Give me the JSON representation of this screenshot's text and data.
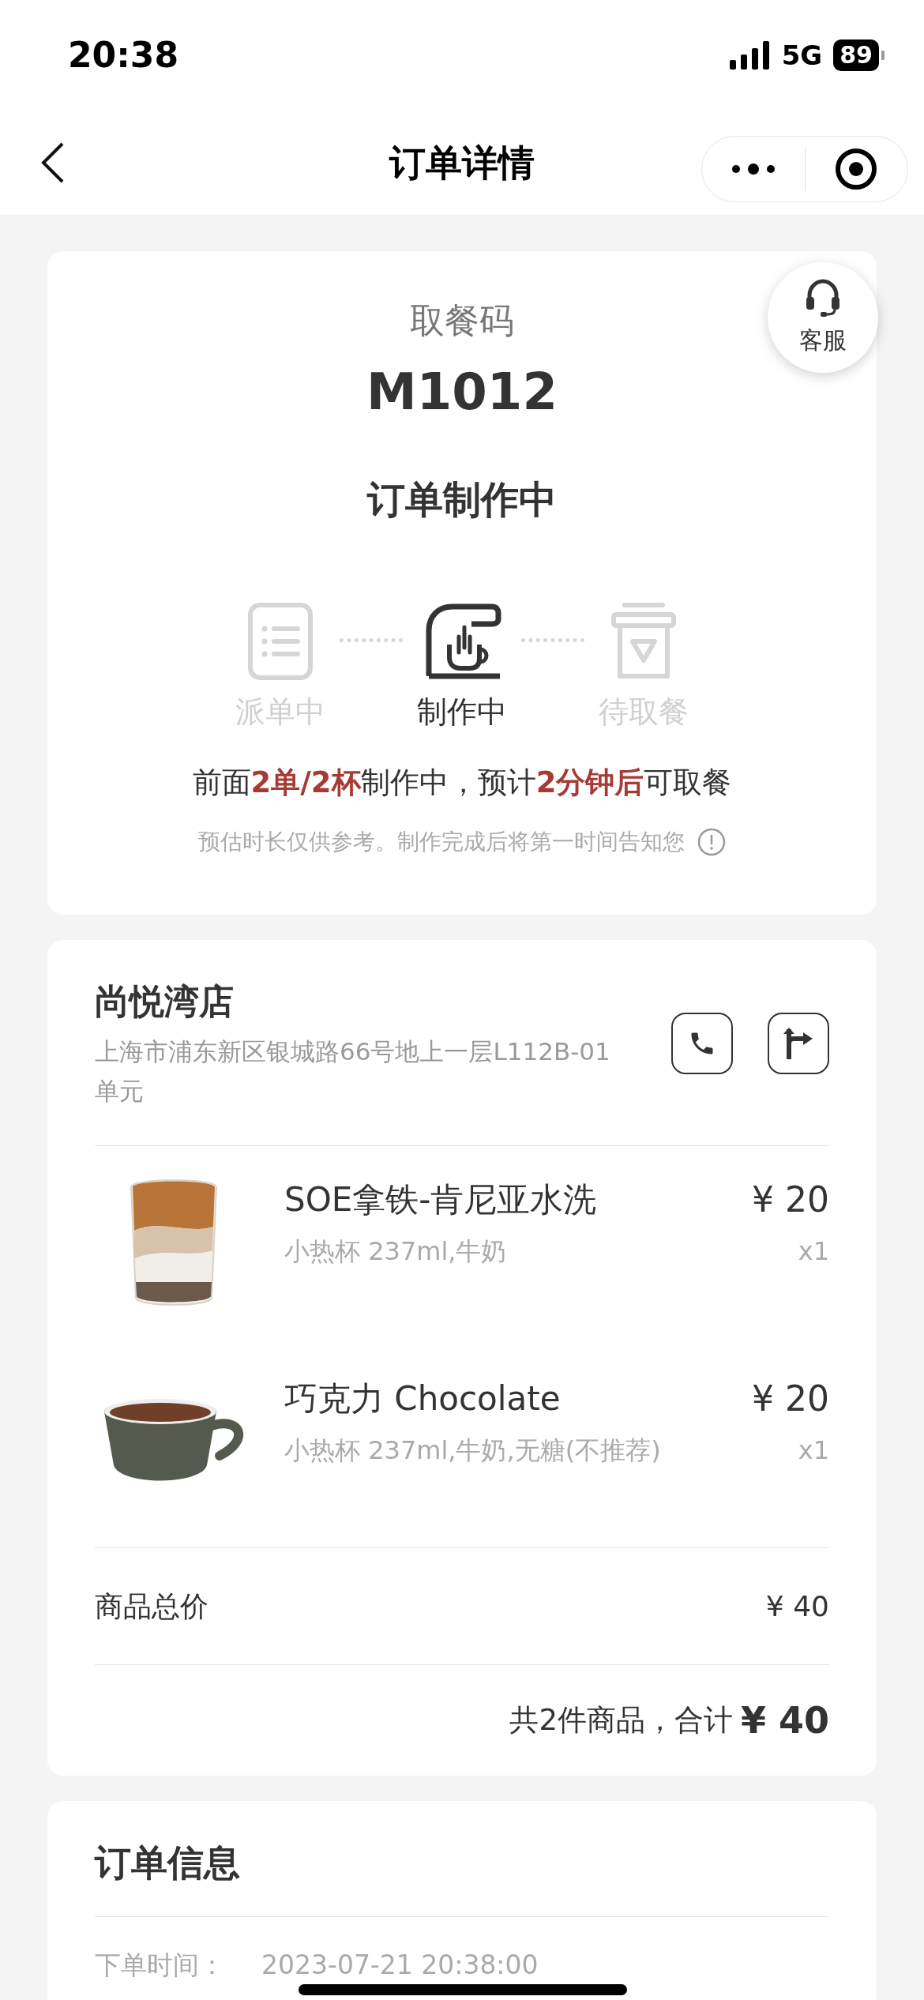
{
  "status_bar": {
    "time": "20:38",
    "network": "5G",
    "battery": "89"
  },
  "nav": {
    "title": "订单详情"
  },
  "pickup": {
    "label": "取餐码",
    "code": "M1012",
    "status": "订单制作中",
    "service": "客服",
    "steps": [
      {
        "kind": "dispatch",
        "label": "派单中",
        "selected": false
      },
      {
        "kind": "making",
        "label": "制作中",
        "selected": true
      },
      {
        "kind": "pickup",
        "label": "待取餐",
        "selected": false
      }
    ],
    "message": [
      {
        "text": "前面",
        "highlight": false
      },
      {
        "text": "2单/2杯",
        "highlight": true
      },
      {
        "text": "制作中，预计",
        "highlight": false
      },
      {
        "text": "2分钟后",
        "highlight": true
      },
      {
        "text": "可取餐",
        "highlight": false
      }
    ],
    "note": "预估时长仅供参考。制作完成后将第一时间告知您"
  },
  "store": {
    "name": "尚悦湾店",
    "address": "上海市浦东新区银城路66号地上一层L112B-01单元"
  },
  "items": [
    {
      "kind": "glass",
      "name": "SOE拿铁-肯尼亚水洗",
      "options": "小热杯 237ml,牛奶",
      "price": "¥ 20",
      "qty": "x1"
    },
    {
      "kind": "cup",
      "name": "巧克力 Chocolate",
      "options": "小热杯 237ml,牛奶,无糖(不推荐)",
      "price": "¥ 20",
      "qty": "x1"
    }
  ],
  "subtotal": {
    "label": "商品总价",
    "value": "¥ 40"
  },
  "summary": {
    "text": "共2件商品，合计",
    "amount": "¥ 40"
  },
  "order_info": {
    "title": "订单信息",
    "rows": [
      {
        "label": "下单时间：",
        "value": "2023-07-21 20:38:00"
      }
    ]
  }
}
